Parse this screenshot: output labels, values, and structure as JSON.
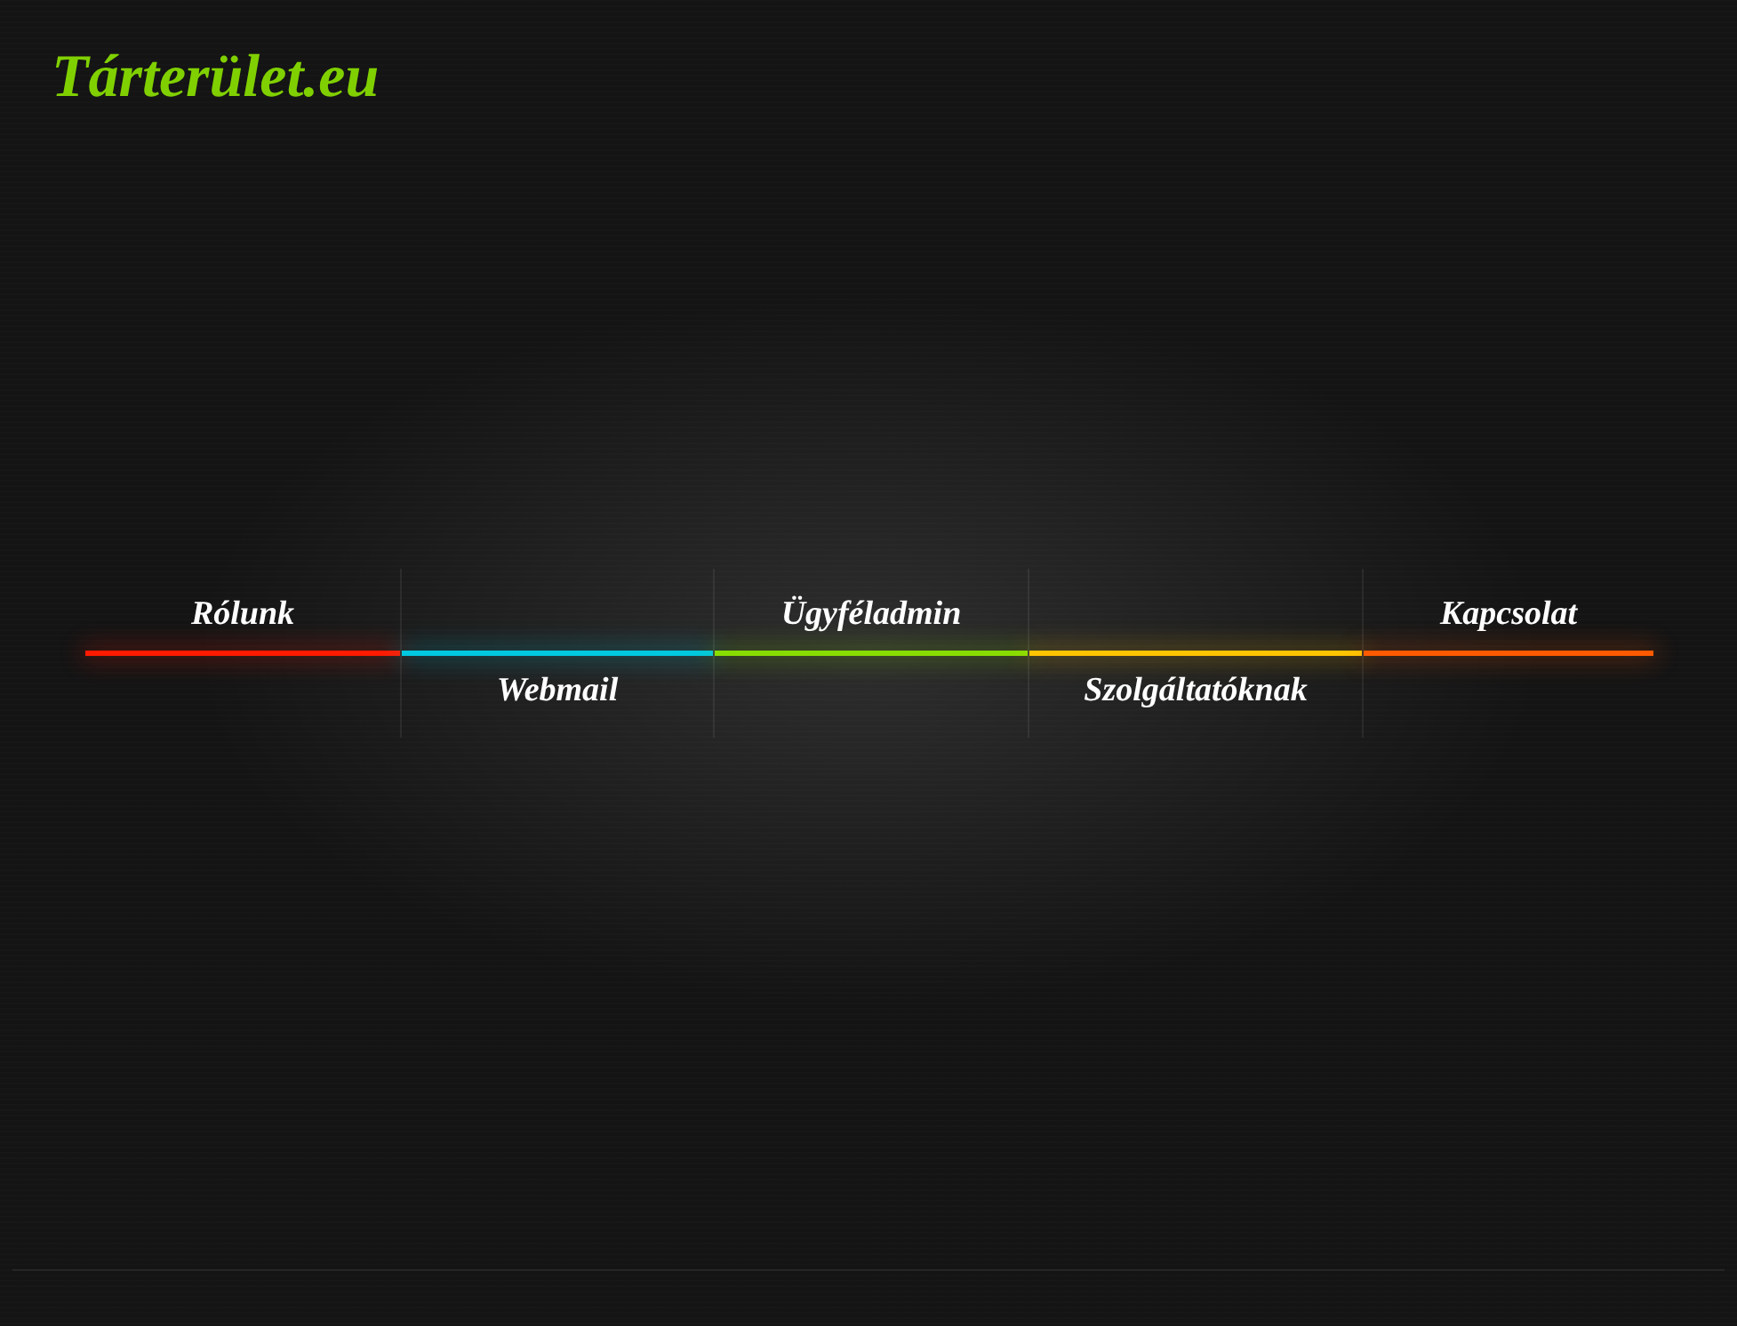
{
  "logo": {
    "text": "Tárterület.eu"
  },
  "nav": {
    "items": [
      {
        "label": "Rólunk",
        "kind": "above",
        "color": "#ff1a00"
      },
      {
        "label": "Webmail",
        "kind": "below",
        "color": "#00c8e0"
      },
      {
        "label": "Ügyféladmin",
        "kind": "above",
        "color": "#88dd00"
      },
      {
        "label": "Szolgáltatóknak",
        "kind": "below",
        "color": "#ffc400"
      },
      {
        "label": "Kapcsolat",
        "kind": "above",
        "color": "#ff5a00"
      }
    ]
  }
}
